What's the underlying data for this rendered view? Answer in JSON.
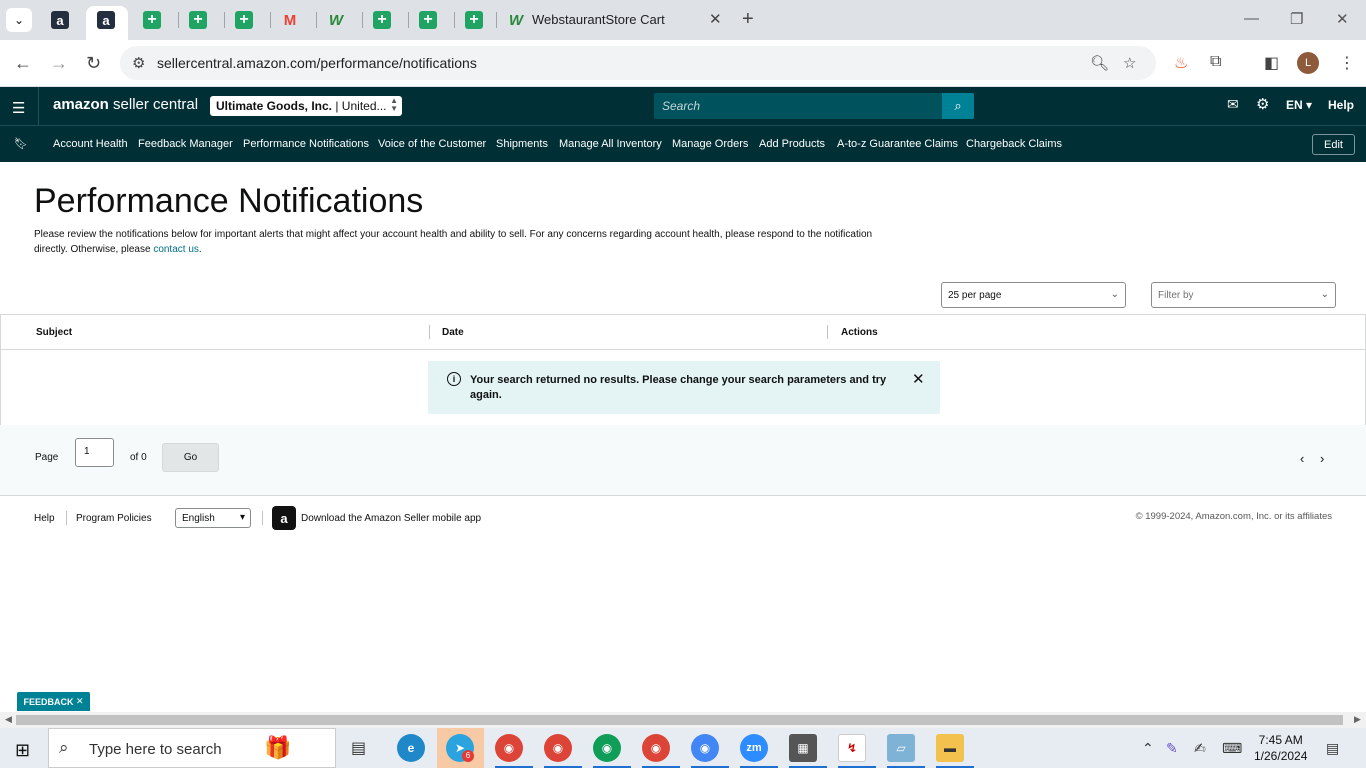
{
  "browser": {
    "active_tab_title": "WebstaurantStore Cart",
    "url": "sellercentral.amazon.com/performance/notifications"
  },
  "header": {
    "logo_main": "amazon",
    "logo_sub": "seller central",
    "account_name": "Ultimate Goods, Inc.",
    "account_region": "| United...",
    "search_placeholder": "Search",
    "language": "EN",
    "help": "Help"
  },
  "nav": {
    "items": [
      "Account Health",
      "Feedback Manager",
      "Performance Notifications",
      "Voice of the Customer",
      "Shipments",
      "Manage All Inventory",
      "Manage Orders",
      "Add Products",
      "A-to-z Guarantee Claims",
      "Chargeback Claims"
    ],
    "edit": "Edit"
  },
  "page": {
    "title": "Performance Notifications",
    "description": "Please review the notifications below for important alerts that might affect your account health and ability to sell. For any concerns regarding account health, please respond to the notification directly. Otherwise, please ",
    "contact_link": "contact us",
    "description_end": "."
  },
  "controls": {
    "per_page": "25 per page",
    "filter_placeholder": "Filter by"
  },
  "table": {
    "columns": [
      "Subject",
      "Date",
      "Actions"
    ],
    "empty_message": "Your search returned no results. Please change your search parameters and try again."
  },
  "pager": {
    "page_label": "Page",
    "page_value": "1",
    "of_label": "of 0",
    "go": "Go"
  },
  "footer": {
    "help": "Help",
    "program_policies": "Program Policies",
    "language": "English",
    "app_download": "Download the Amazon Seller mobile app",
    "copyright": "© 1999-2024, Amazon.com, Inc. or its affiliates"
  },
  "feedback": "FEEDBACK",
  "taskbar": {
    "search_placeholder": "Type here to search",
    "time": "7:45 AM",
    "date": "1/26/2024",
    "badge_count": "6"
  },
  "colors": {
    "header_bg": "#002f36",
    "search_btn": "#008296",
    "link": "#007185",
    "alert_bg": "#e4f4f4"
  }
}
